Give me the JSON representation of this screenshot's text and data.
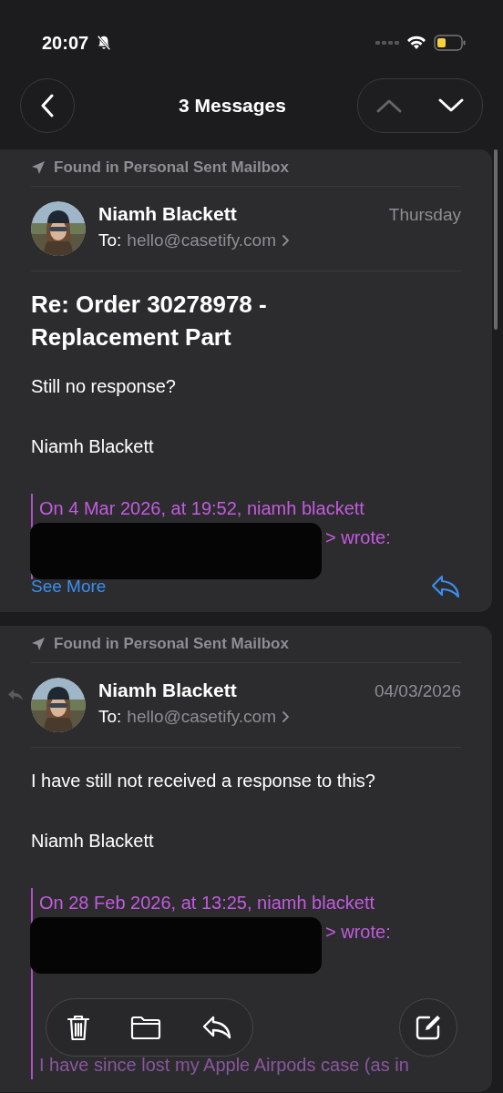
{
  "status_bar": {
    "time": "20:07"
  },
  "nav": {
    "title": "3 Messages",
    "up_disabled": true
  },
  "messages": [
    {
      "found_in": "Found in Personal Sent Mailbox",
      "sender": "Niamh Blackett",
      "to_label": "To:",
      "to": "hello@casetify.com",
      "date": "Thursday",
      "replied": false,
      "subject": "Re: Order 30278978 - Replacement Part",
      "body": [
        "Still no response?",
        "Niamh Blackett"
      ],
      "quote": {
        "line": "On 4 Mar 2026, at 19:52, niamh blackett",
        "tail": "> wrote:"
      },
      "see_more": "See More"
    },
    {
      "found_in": "Found in Personal Sent Mailbox",
      "sender": "Niamh Blackett",
      "to_label": "To:",
      "to": "hello@casetify.com",
      "date": "04/03/2026",
      "replied": true,
      "body": [
        "I have still not received a response to this?",
        "Niamh Blackett"
      ],
      "quote": {
        "line": "On 28 Feb 2026, at 13:25, niamh blackett",
        "tail": "> wrote:",
        "faded": "I have since lost my Apple Airpods case (as in"
      }
    }
  ]
}
